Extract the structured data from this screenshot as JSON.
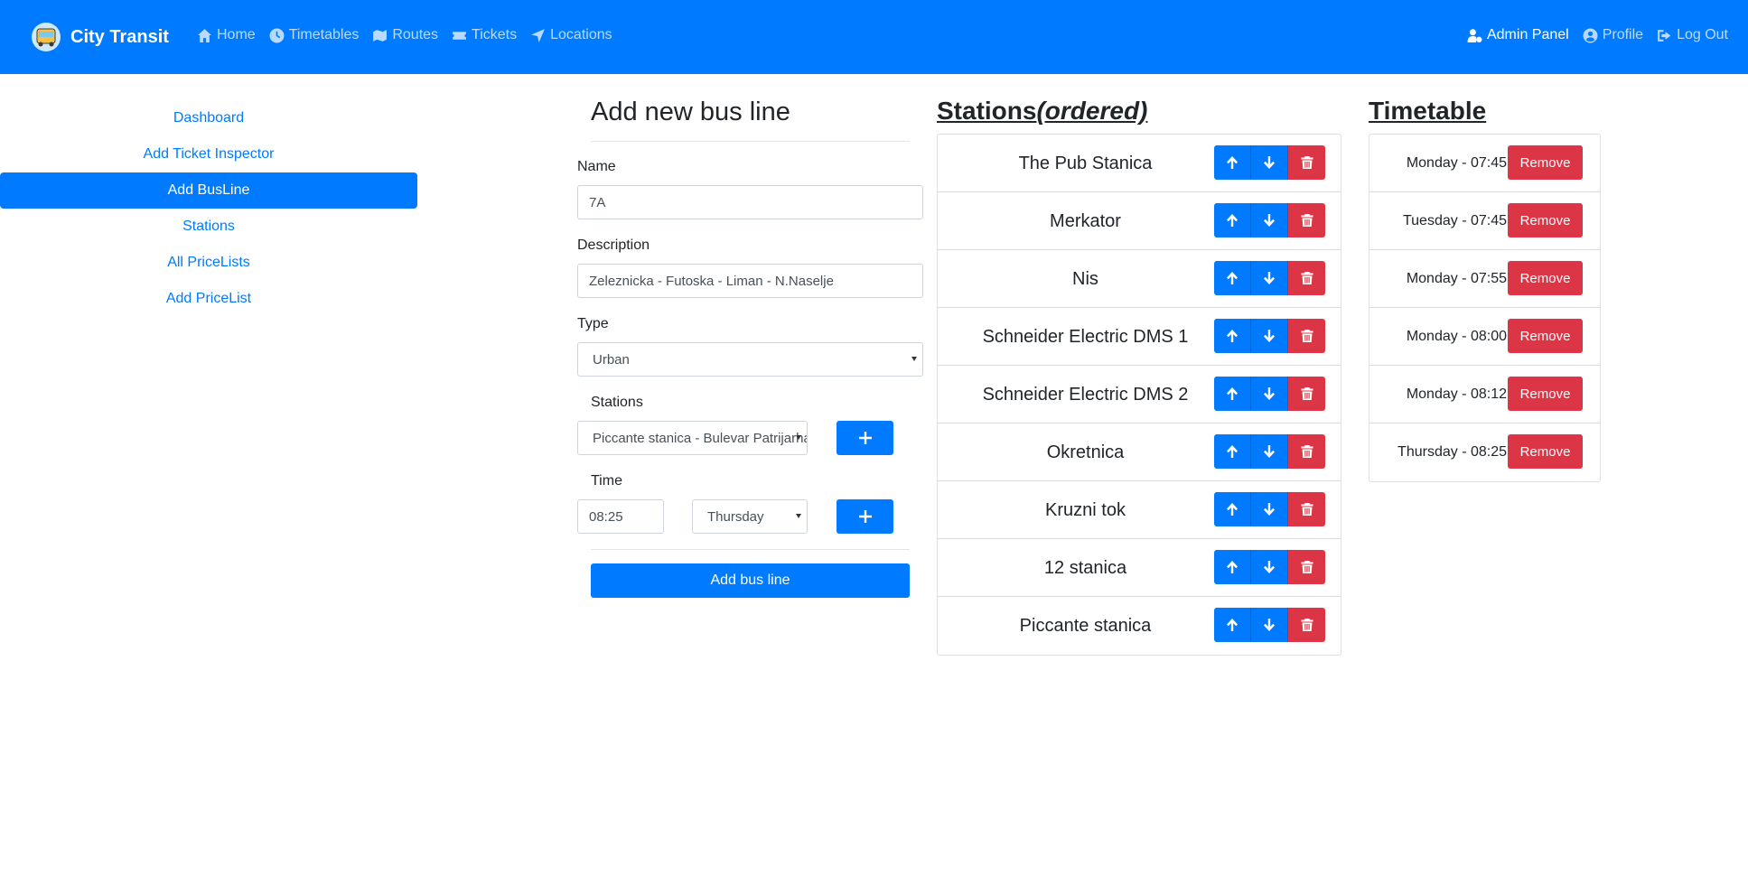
{
  "navbar": {
    "brand": "City Transit",
    "links": [
      {
        "label": "Home",
        "icon": "home-icon"
      },
      {
        "label": "Timetables",
        "icon": "clock-icon"
      },
      {
        "label": "Routes",
        "icon": "map-icon"
      },
      {
        "label": "Tickets",
        "icon": "ticket-icon"
      },
      {
        "label": "Locations",
        "icon": "location-arrow-icon"
      }
    ],
    "right": [
      {
        "label": "Admin Panel",
        "icon": "user-cog-icon"
      },
      {
        "label": "Profile",
        "icon": "user-circle-icon"
      },
      {
        "label": "Log Out",
        "icon": "sign-out-icon"
      }
    ]
  },
  "sidebar": {
    "items": [
      {
        "label": "Dashboard"
      },
      {
        "label": "Add Ticket Inspector"
      },
      {
        "label": "Add BusLine",
        "active": true
      },
      {
        "label": "Stations"
      },
      {
        "label": "All PriceLists"
      },
      {
        "label": "Add PriceList"
      }
    ]
  },
  "form": {
    "title": "Add new bus line",
    "name_label": "Name",
    "name_value": "7A",
    "description_label": "Description",
    "description_value": "Zeleznicka - Futoska - Liman - N.Naselje",
    "type_label": "Type",
    "type_value": "Urban",
    "stations_label": "Stations",
    "station_select_value": "Piccante stanica - Bulevar Patrijarha Pavla",
    "time_label": "Time",
    "time_value": "08:25",
    "day_value": "Thursday",
    "submit_label": "Add bus line"
  },
  "stations": {
    "title": "Stations",
    "title_suffix": "(ordered)",
    "items": [
      "The Pub Stanica",
      "Merkator",
      "Nis",
      "Schneider Electric DMS 1",
      "Schneider Electric DMS 2",
      "Okretnica",
      "Kruzni tok",
      "12 stanica",
      "Piccante stanica"
    ]
  },
  "timetable": {
    "title": "Timetable",
    "remove_label": "Remove",
    "items": [
      "Monday - 07:45",
      "Tuesday - 07:45",
      "Monday - 07:55",
      "Monday - 08:00",
      "Monday - 08:12",
      "Thursday - 08:25"
    ]
  },
  "colors": {
    "primary": "#007bff",
    "danger": "#dc3545"
  }
}
